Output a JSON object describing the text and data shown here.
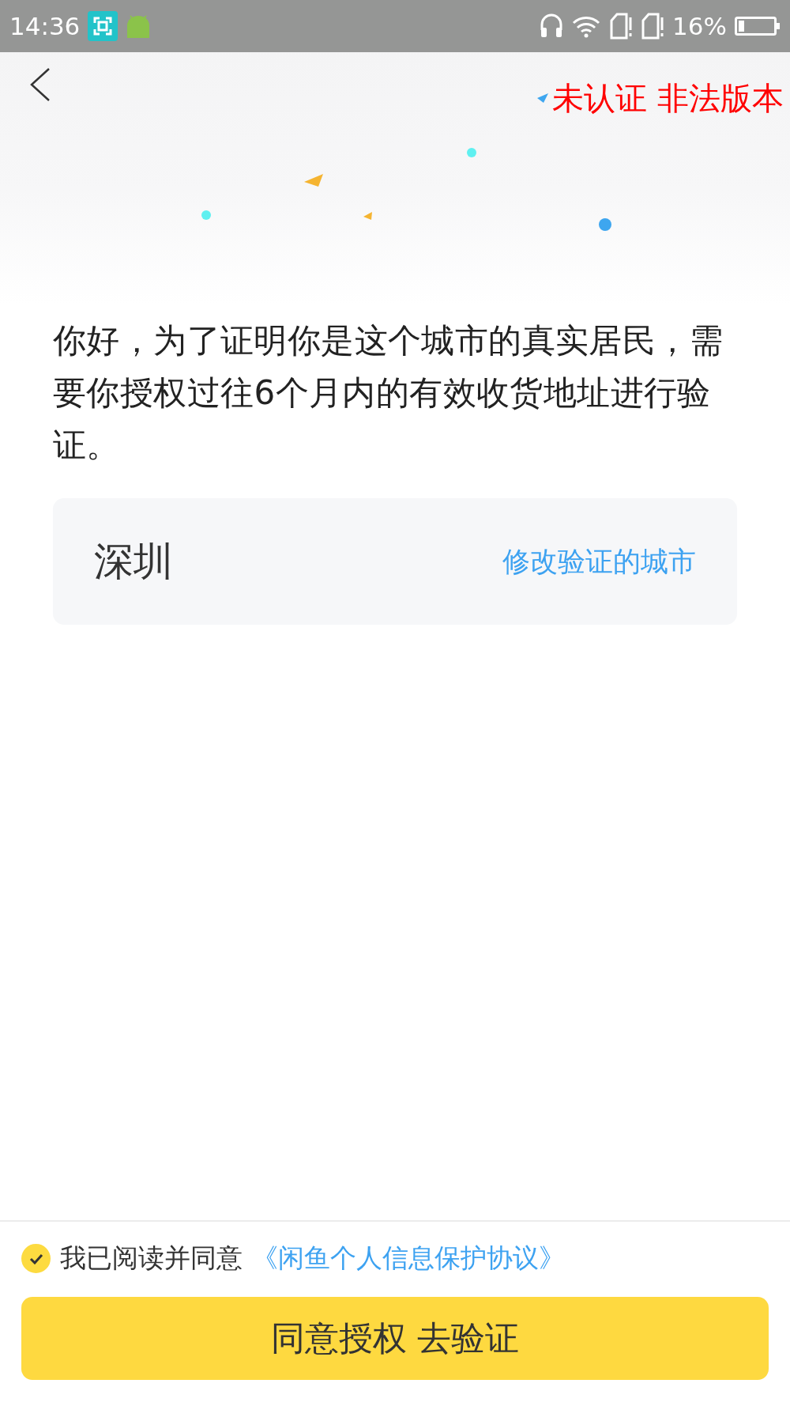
{
  "status_bar": {
    "time": "14:36",
    "battery": "16%"
  },
  "header": {
    "overlay_text": "未认证 非法版本"
  },
  "intro": "你好，为了证明你是这个城市的真实居民，需要你授权过往6个月内的有效收货地址进行验证。",
  "city_card": {
    "city": "深圳",
    "change_link": "修改验证的城市"
  },
  "agreement": {
    "checked": true,
    "text": "我已阅读并同意",
    "link": "《闲鱼个人信息保护协议》"
  },
  "primary_button": "同意授权 去验证"
}
